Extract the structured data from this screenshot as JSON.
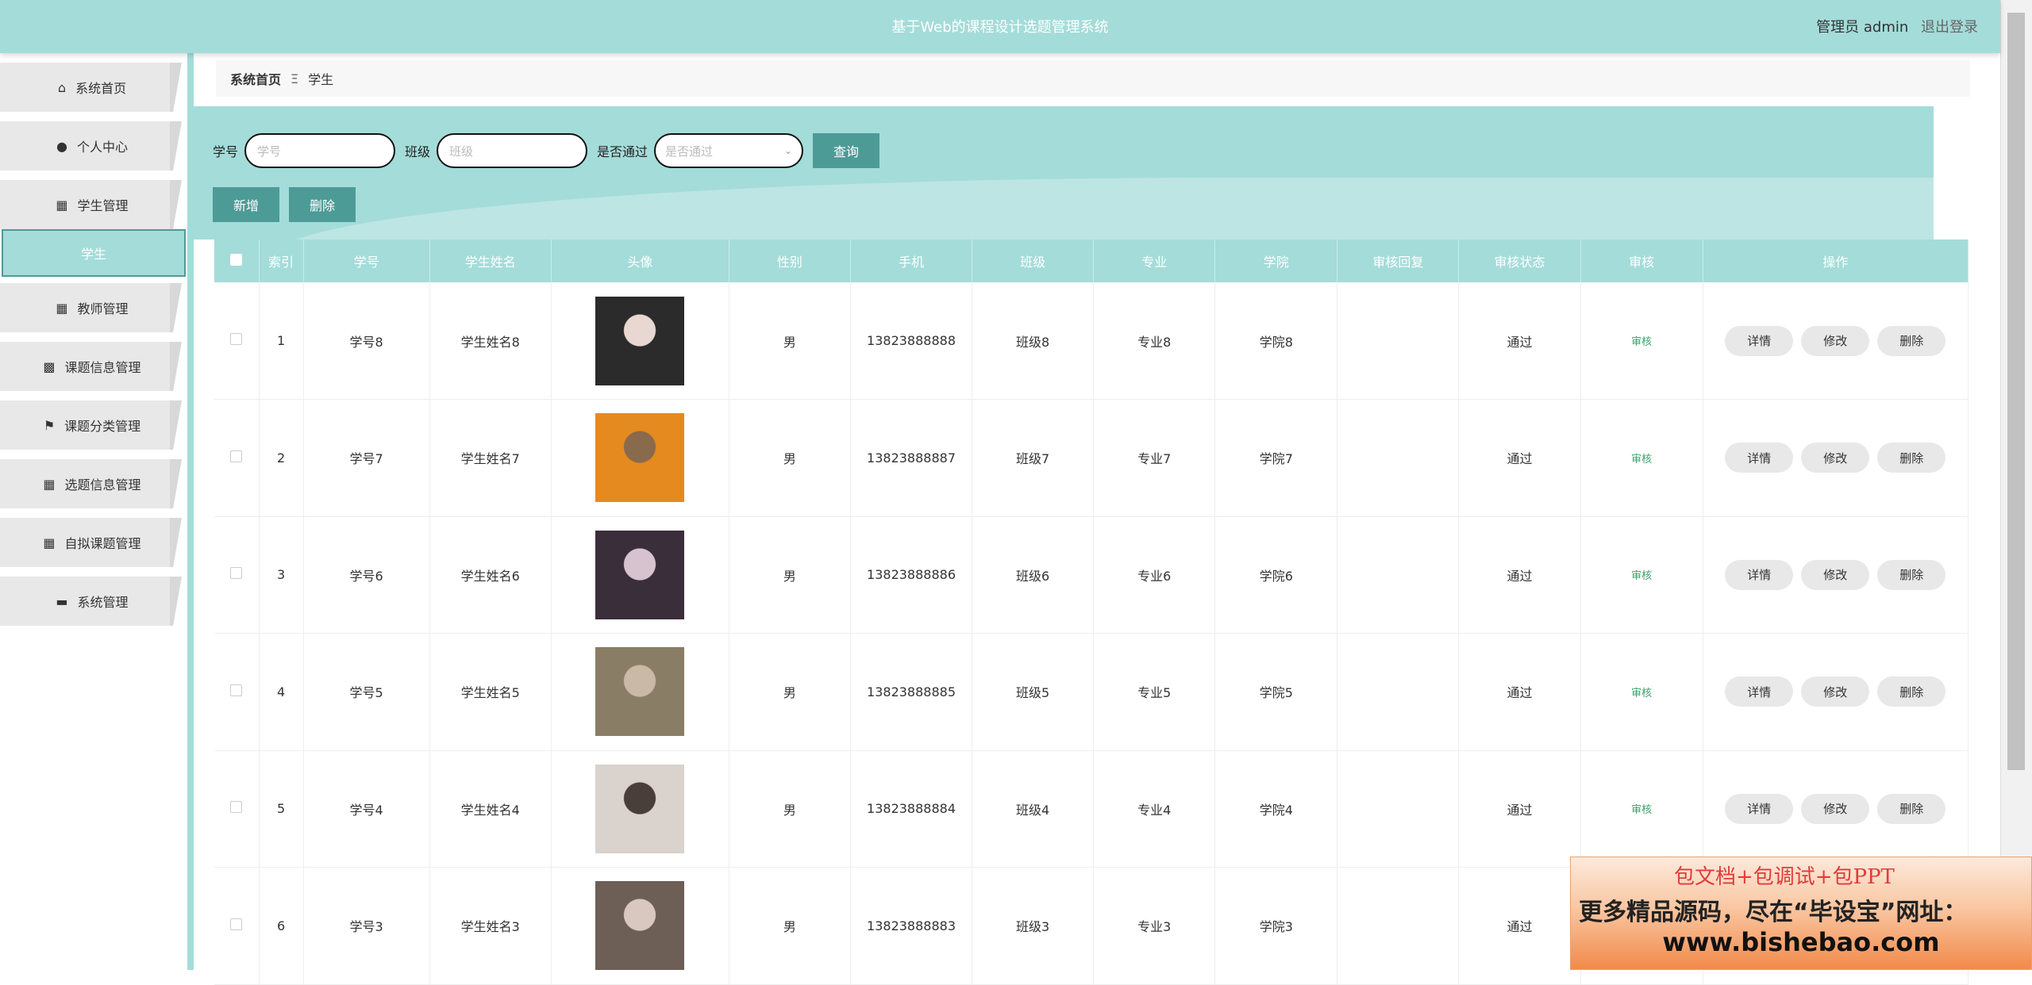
{
  "header": {
    "title": "基于Web的课程设计选题管理系统",
    "user_label": "管理员 admin",
    "logout": "退出登录"
  },
  "sidebar": {
    "items": [
      {
        "label": "系统首页",
        "icon": "home-icon",
        "glyph": "⌂"
      },
      {
        "label": "个人中心",
        "icon": "user-icon",
        "glyph": "👤"
      },
      {
        "label": "学生管理",
        "icon": "grid-icon",
        "glyph": "▦"
      },
      {
        "label": "学生",
        "icon": "",
        "glyph": ""
      },
      {
        "label": "教师管理",
        "icon": "grid-icon",
        "glyph": "▦"
      },
      {
        "label": "课题信息管理",
        "icon": "apps-icon",
        "glyph": "▩"
      },
      {
        "label": "课题分类管理",
        "icon": "flag-icon",
        "glyph": "⚑"
      },
      {
        "label": "选题信息管理",
        "icon": "grid-icon",
        "glyph": "▦"
      },
      {
        "label": "自拟课题管理",
        "icon": "grid-icon",
        "glyph": "▦"
      },
      {
        "label": "系统管理",
        "icon": "system-icon",
        "glyph": "▬"
      }
    ]
  },
  "breadcrumb": {
    "home": "系统首页",
    "sep": "Ξ",
    "current": "学生"
  },
  "search": {
    "xuehao_label": "学号",
    "xuehao_placeholder": "学号",
    "banji_label": "班级",
    "banji_placeholder": "班级",
    "pass_label": "是否通过",
    "pass_placeholder": "是否通过",
    "query_button": "查询",
    "add_button": "新增",
    "delete_button": "删除"
  },
  "table": {
    "headers": [
      "",
      "索引",
      "学号",
      "学生姓名",
      "头像",
      "性别",
      "手机",
      "班级",
      "专业",
      "学院",
      "审核回复",
      "审核状态",
      "审核",
      "操作"
    ],
    "rows": [
      {
        "index": "1",
        "xuehao": "学号8",
        "name": "学生姓名8",
        "gender": "男",
        "phone": "13823888888",
        "banji": "班级8",
        "zhuanye": "专业8",
        "xueyuan": "学院8",
        "reply": "",
        "status": "通过",
        "audit": "审核"
      },
      {
        "index": "2",
        "xuehao": "学号7",
        "name": "学生姓名7",
        "gender": "男",
        "phone": "13823888887",
        "banji": "班级7",
        "zhuanye": "专业7",
        "xueyuan": "学院7",
        "reply": "",
        "status": "通过",
        "audit": "审核"
      },
      {
        "index": "3",
        "xuehao": "学号6",
        "name": "学生姓名6",
        "gender": "男",
        "phone": "13823888886",
        "banji": "班级6",
        "zhuanye": "专业6",
        "xueyuan": "学院6",
        "reply": "",
        "status": "通过",
        "audit": "审核"
      },
      {
        "index": "4",
        "xuehao": "学号5",
        "name": "学生姓名5",
        "gender": "男",
        "phone": "13823888885",
        "banji": "班级5",
        "zhuanye": "专业5",
        "xueyuan": "学院5",
        "reply": "",
        "status": "通过",
        "audit": "审核"
      },
      {
        "index": "5",
        "xuehao": "学号4",
        "name": "学生姓名4",
        "gender": "男",
        "phone": "13823888884",
        "banji": "班级4",
        "zhuanye": "专业4",
        "xueyuan": "学院4",
        "reply": "",
        "status": "通过",
        "audit": "审核"
      },
      {
        "index": "6",
        "xuehao": "学号3",
        "name": "学生姓名3",
        "gender": "男",
        "phone": "13823888883",
        "banji": "班级3",
        "zhuanye": "专业3",
        "xueyuan": "学院3",
        "reply": "",
        "status": "通过",
        "audit": ""
      }
    ],
    "op_buttons": {
      "detail": "详情",
      "edit": "修改",
      "delete": "删除"
    }
  },
  "watermark": {
    "line1": "包文档+包调试+包PPT",
    "line2": "更多精品源码，尽在“毕设宝”网址：",
    "line3": "www.bishebao.com"
  },
  "colors": {
    "teal": "#a4dcd9",
    "teal_dark": "#4d9b97"
  }
}
